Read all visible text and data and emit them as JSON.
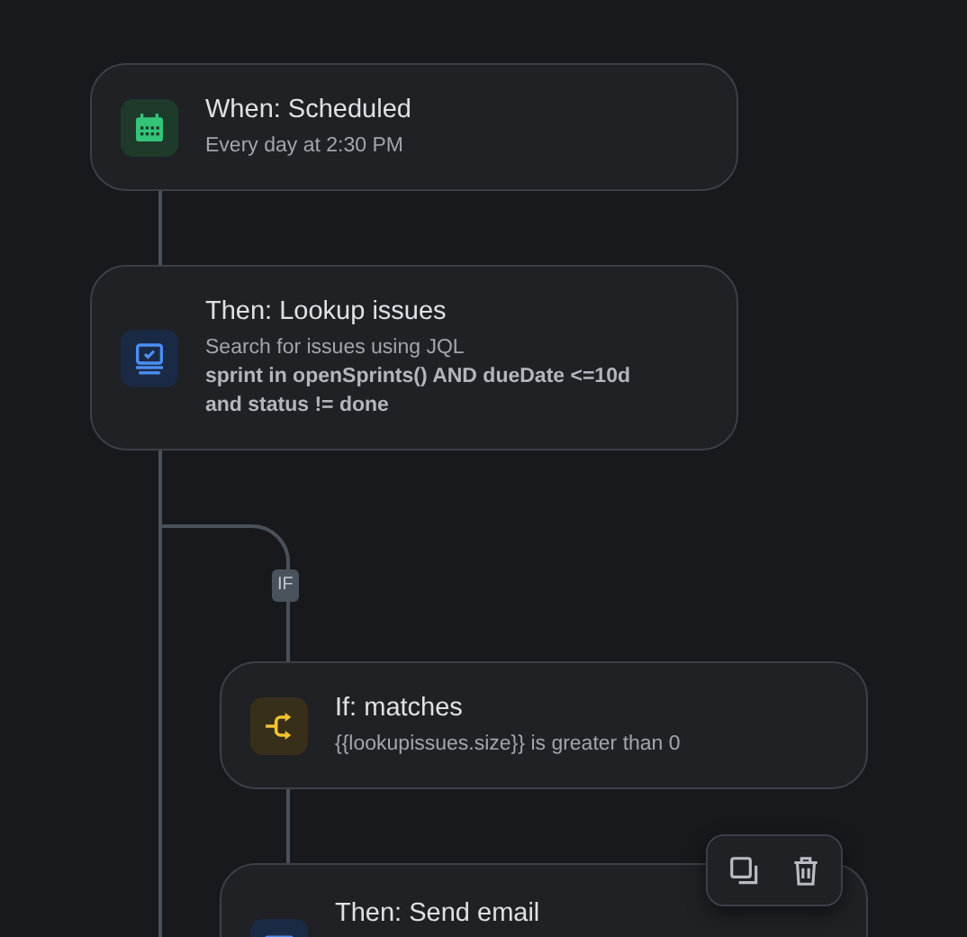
{
  "nodes": [
    {
      "kind": "schedule",
      "title": "When: Scheduled",
      "description": "Every day at 2:30 PM"
    },
    {
      "kind": "lookup",
      "title": "Then: Lookup issues",
      "description": "Search for issues using JQL",
      "query": "sprint in openSprints() AND dueDate <=10d and status != done"
    },
    {
      "kind": "condition",
      "title": "If: matches",
      "description": "{{lookupissues.size}} is greater than 0"
    },
    {
      "kind": "email",
      "title": "Then: Send email"
    }
  ],
  "branch_badge": "IF",
  "toolbar": [
    {
      "kind": "copy"
    },
    {
      "kind": "delete"
    }
  ]
}
